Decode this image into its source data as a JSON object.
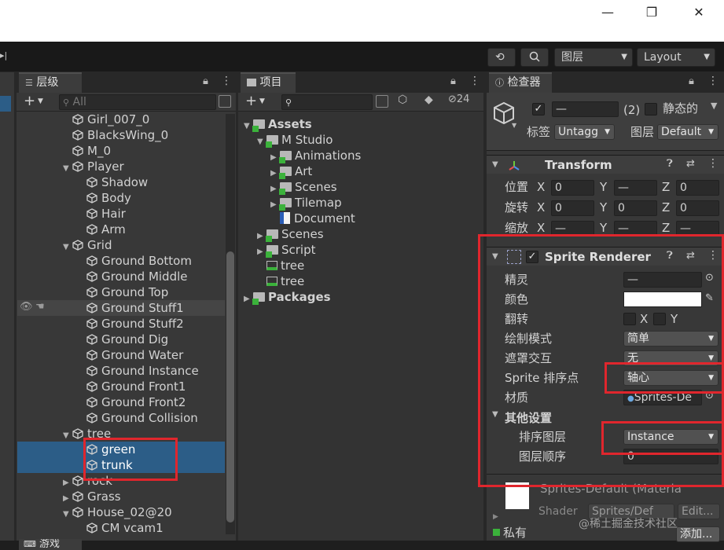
{
  "window": {
    "minimize": "—",
    "restore": "❐",
    "close": "✕"
  },
  "toolbar": {
    "layers_label": "图层",
    "layout_label": "Layout"
  },
  "hierarchy": {
    "tab_label": "层级",
    "search_placeholder": "All",
    "items": [
      {
        "name": "Girl_007_0",
        "indent": 1,
        "fold": ""
      },
      {
        "name": "BlacksWing_0",
        "indent": 1,
        "fold": ""
      },
      {
        "name": "M_0",
        "indent": 1,
        "fold": ""
      },
      {
        "name": "Player",
        "indent": 1,
        "fold": "▼"
      },
      {
        "name": "Shadow",
        "indent": 2,
        "fold": ""
      },
      {
        "name": "Body",
        "indent": 2,
        "fold": ""
      },
      {
        "name": "Hair",
        "indent": 2,
        "fold": ""
      },
      {
        "name": "Arm",
        "indent": 2,
        "fold": ""
      },
      {
        "name": "Grid",
        "indent": 1,
        "fold": "▼"
      },
      {
        "name": "Ground Bottom",
        "indent": 2,
        "fold": ""
      },
      {
        "name": "Ground Middle",
        "indent": 2,
        "fold": ""
      },
      {
        "name": "Ground Top",
        "indent": 2,
        "fold": ""
      },
      {
        "name": "Ground Stuff1",
        "indent": 2,
        "fold": ""
      },
      {
        "name": "Ground Stuff2",
        "indent": 2,
        "fold": ""
      },
      {
        "name": "Ground Dig",
        "indent": 2,
        "fold": ""
      },
      {
        "name": "Ground Water",
        "indent": 2,
        "fold": ""
      },
      {
        "name": "Ground Instance",
        "indent": 2,
        "fold": ""
      },
      {
        "name": "Ground Front1",
        "indent": 2,
        "fold": ""
      },
      {
        "name": "Ground Front2",
        "indent": 2,
        "fold": ""
      },
      {
        "name": "Ground Collision",
        "indent": 2,
        "fold": ""
      },
      {
        "name": "tree",
        "indent": 1,
        "fold": "▼"
      },
      {
        "name": "green",
        "indent": 2,
        "fold": "",
        "selected": true
      },
      {
        "name": "trunk",
        "indent": 2,
        "fold": "",
        "selected": true
      },
      {
        "name": "rock",
        "indent": 1,
        "fold": "▶"
      },
      {
        "name": "Grass",
        "indent": 1,
        "fold": "▶"
      },
      {
        "name": "House_02@20",
        "indent": 1,
        "fold": "▼"
      },
      {
        "name": "CM vcam1",
        "indent": 2,
        "fold": ""
      }
    ]
  },
  "project": {
    "tab_label": "项目",
    "hidden_count": "24",
    "items": [
      {
        "name": "Assets",
        "indent": 0,
        "fold": "▼",
        "bold": true,
        "kind": "folder"
      },
      {
        "name": "M Studio",
        "indent": 1,
        "fold": "▼",
        "kind": "folder"
      },
      {
        "name": "Animations",
        "indent": 2,
        "fold": "▶",
        "kind": "folder"
      },
      {
        "name": "Art",
        "indent": 2,
        "fold": "▶",
        "kind": "folder"
      },
      {
        "name": "Scenes",
        "indent": 2,
        "fold": "▶",
        "kind": "folder"
      },
      {
        "name": "Tilemap",
        "indent": 2,
        "fold": "▶",
        "kind": "folder"
      },
      {
        "name": "Document",
        "indent": 2,
        "fold": "",
        "kind": "doc"
      },
      {
        "name": "Scenes",
        "indent": 1,
        "fold": "▶",
        "kind": "folder"
      },
      {
        "name": "Script",
        "indent": 1,
        "fold": "▶",
        "kind": "folder"
      },
      {
        "name": "tree",
        "indent": 1,
        "fold": "",
        "kind": "anim"
      },
      {
        "name": "tree",
        "indent": 1,
        "fold": "",
        "kind": "anim"
      },
      {
        "name": "Packages",
        "indent": 0,
        "fold": "▶",
        "bold": true,
        "kind": "folder"
      }
    ]
  },
  "inspector": {
    "tab_label": "检查器",
    "object_name": "—",
    "count": "(2)",
    "static_label": "静态的",
    "tag_label": "标签",
    "tag_value": "Untagg",
    "layer_label": "图层",
    "layer_value": "Default",
    "transform": {
      "title": "Transform",
      "position_label": "位置",
      "rotation_label": "旋转",
      "scale_label": "缩放",
      "x": "X",
      "y": "Y",
      "z": "Z",
      "position": [
        "0",
        "—",
        "0"
      ],
      "rotation": [
        "0",
        "0",
        "0"
      ],
      "scale": [
        "—",
        "—",
        "—"
      ]
    },
    "sprite_renderer": {
      "title": "Sprite Renderer",
      "sprite_label": "精灵",
      "sprite_value": "—",
      "color_label": "颜色",
      "flip_label": "翻转",
      "flip_x": "X",
      "flip_y": "Y",
      "draw_mode_label": "绘制模式",
      "draw_mode_value": "简单",
      "mask_label": "遮罩交互",
      "mask_value": "无",
      "sort_point_label": "Sprite 排序点",
      "sort_point_value": "轴心",
      "material_label": "材质",
      "material_value": "Sprites-De",
      "other_settings_label": "其他设置",
      "sorting_layer_label": "排序图层",
      "sorting_layer_value": "Instance",
      "order_label": "图层顺序",
      "order_value": "0"
    },
    "material": {
      "name": "Sprites-Default (Materia",
      "shader_label": "Shader",
      "shader_value": "Sprites/Def",
      "edit_label": "Edit...",
      "private_label": "私有",
      "add_label": "添加..."
    }
  },
  "game_tab": {
    "label": "游戏"
  },
  "watermark": "@稀土掘金技术社区"
}
